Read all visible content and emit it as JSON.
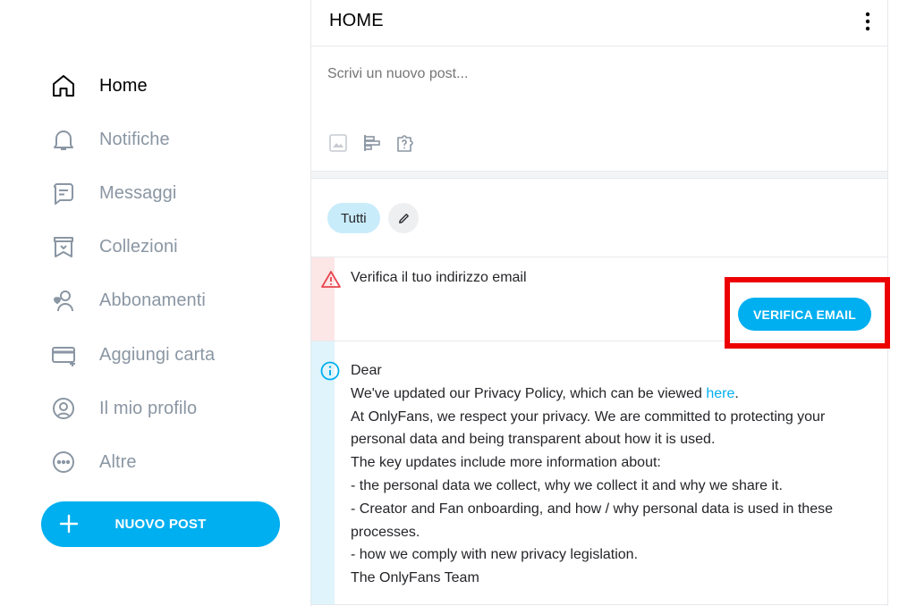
{
  "sidebar": {
    "items": [
      {
        "label": "Home",
        "icon": "home-icon",
        "active": true
      },
      {
        "label": "Notifiche",
        "icon": "bell-icon"
      },
      {
        "label": "Messaggi",
        "icon": "message-icon"
      },
      {
        "label": "Collezioni",
        "icon": "collections-icon"
      },
      {
        "label": "Abbonamenti",
        "icon": "subscriptions-icon"
      },
      {
        "label": "Aggiungi carta",
        "icon": "add-card-icon"
      },
      {
        "label": "Il mio profilo",
        "icon": "profile-icon"
      },
      {
        "label": "Altre",
        "icon": "more-icon"
      }
    ],
    "new_post_label": "NUOVO POST"
  },
  "header": {
    "title": "HOME"
  },
  "composer": {
    "placeholder": "Scrivi un nuovo post..."
  },
  "filters": {
    "chip_label": "Tutti"
  },
  "email_alert": {
    "text": "Verifica il tuo indirizzo email",
    "button_label": "VERIFICA EMAIL"
  },
  "privacy_notice": {
    "greeting": "Dear",
    "line1_prefix": "We've updated our Privacy Policy, which can be viewed ",
    "line1_link": "here",
    "line1_suffix": ".",
    "line2": "At OnlyFans, we respect your privacy. We are committed to protecting your personal data and being transparent about how it is used.",
    "line3": "The key updates include more information about:",
    "line4": "- the personal data we collect, why we collect it and why we share it.",
    "line5": "- Creator and Fan onboarding, and how / why personal data is used in these processes.",
    "line6": "- how we comply with new privacy legislation.",
    "signature": "The OnlyFans Team"
  },
  "colors": {
    "accent": "#00aff0",
    "highlight": "#ec0000",
    "muted": "#8a96a3"
  }
}
